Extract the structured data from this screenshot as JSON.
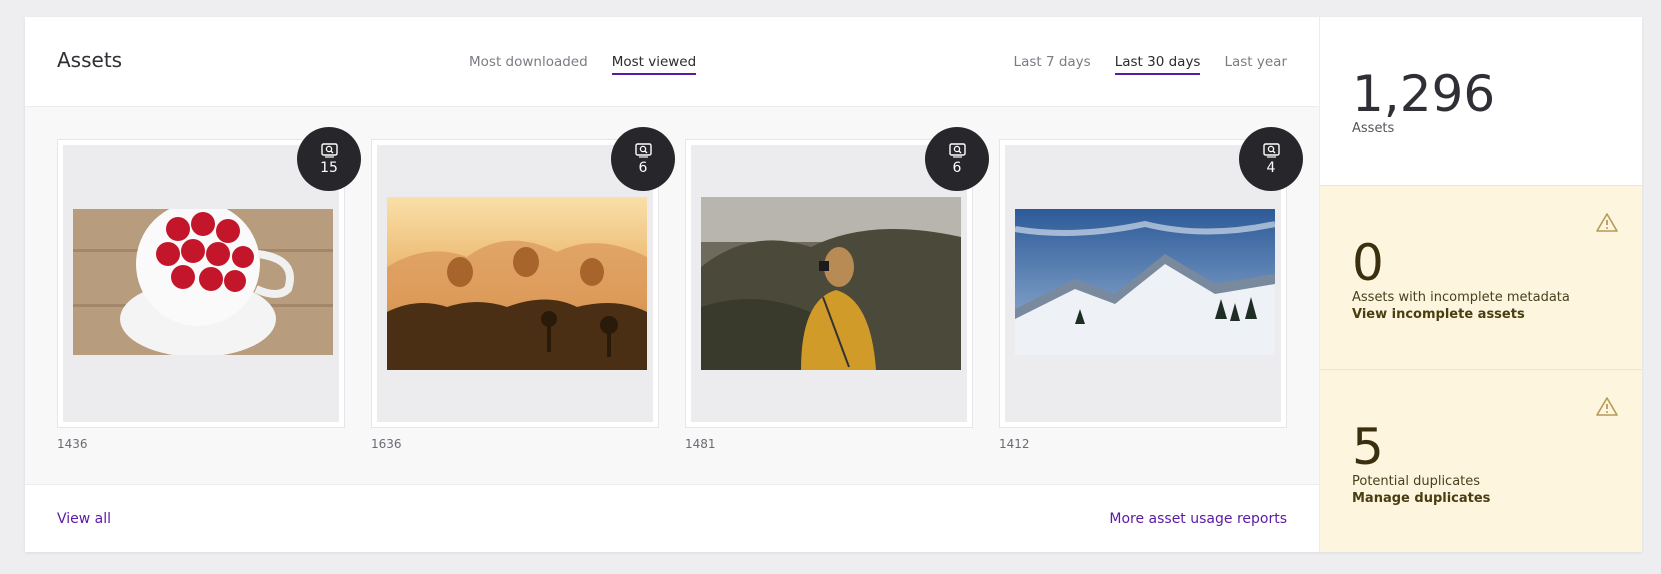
{
  "header": {
    "title": "Assets",
    "metric_tabs": [
      {
        "label": "Most downloaded",
        "active": false
      },
      {
        "label": "Most viewed",
        "active": true
      }
    ],
    "range_tabs": [
      {
        "label": "Last 7 days",
        "active": false
      },
      {
        "label": "Last 30 days",
        "active": true
      },
      {
        "label": "Last year",
        "active": false
      }
    ]
  },
  "assets": [
    {
      "id": "1436",
      "views": "15",
      "image": "raspberries-cup"
    },
    {
      "id": "1636",
      "views": "6",
      "image": "hot-air-balloons-sunrise"
    },
    {
      "id": "1481",
      "views": "6",
      "image": "woman-photographing-cliffs"
    },
    {
      "id": "1412",
      "views": "4",
      "image": "snowy-mountains"
    }
  ],
  "footer": {
    "view_all": "View all",
    "more_reports": "More asset usage reports"
  },
  "stats": {
    "total": {
      "value": "1,296",
      "label": "Assets"
    },
    "incomplete": {
      "value": "0",
      "label": "Assets with incomplete metadata",
      "link": "View incomplete assets"
    },
    "duplicates": {
      "value": "5",
      "label": "Potential duplicates",
      "link": "Manage duplicates"
    }
  },
  "colors": {
    "accent": "#5a1aa6",
    "warning_bg": "#fdf5dd",
    "badge_bg": "#26262b"
  }
}
